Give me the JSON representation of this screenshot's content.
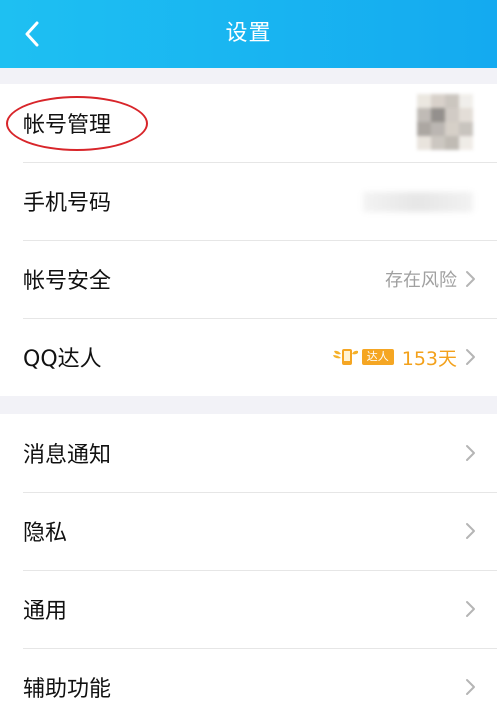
{
  "header": {
    "title": "设置"
  },
  "section1": {
    "items": [
      {
        "label": "帐号管理"
      },
      {
        "label": "手机号码"
      },
      {
        "label": "帐号安全",
        "value": "存在风险"
      },
      {
        "label": "QQ达人",
        "badge": "达人",
        "value": "153天"
      }
    ]
  },
  "section2": {
    "items": [
      {
        "label": "消息通知"
      },
      {
        "label": "隐私"
      },
      {
        "label": "通用"
      },
      {
        "label": "辅助功能"
      }
    ]
  },
  "colors": {
    "header": "#14aaf0",
    "orange": "#f3a11b",
    "highlight_circle": "#d8252a"
  }
}
